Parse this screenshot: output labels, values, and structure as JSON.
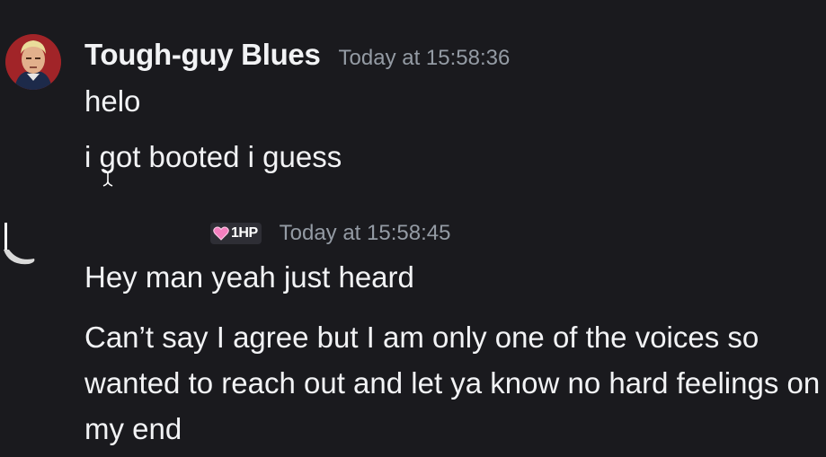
{
  "messages": [
    {
      "username": "Tough-guy Blues",
      "timestamp": "Today at  15:58:36",
      "lines": [
        "helo",
        "i got booted i guess"
      ],
      "avatar": "character-portrait-avatar"
    },
    {
      "username": "",
      "role_badge": "1HP",
      "role_icon": "pink-heart-icon",
      "timestamp": "Today at  15:58:45",
      "lines": [
        "Hey man yeah just heard",
        "Can’t say I agree but I am only one of the voices so wanted to reach out and let ya know no hard feelings on my end"
      ],
      "avatar": "partial-avatar"
    }
  ],
  "colors": {
    "background": "#1a1a1e",
    "username": "#f2f3f5",
    "timestamp": "#949ba4",
    "message_text": "#f2f3f5",
    "badge_bg": "#2e2e35",
    "heart": "#f47fbf"
  }
}
